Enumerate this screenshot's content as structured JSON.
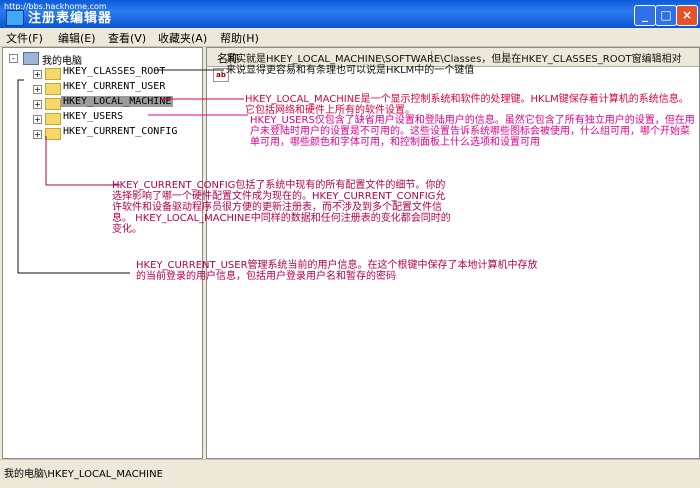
{
  "titlebar": {
    "watermark": "http://bbs.hackhome.com",
    "title": "注册表编辑器",
    "min_glyph": "_",
    "max_glyph": "□",
    "close_glyph": "×"
  },
  "menu": {
    "items": [
      "文件(F)",
      "编辑(E)",
      "查看(V)",
      "收藏夹(A)",
      "帮助(H)"
    ]
  },
  "tree": {
    "root_label": "我的电脑",
    "expander_plus": "+",
    "expander_minus": "-",
    "items": [
      {
        "label": "HKEY_CLASSES_ROOT",
        "selected": false
      },
      {
        "label": "HKEY_CURRENT_USER",
        "selected": false
      },
      {
        "label": "HKEY_LOCAL_MACHINE",
        "selected": true
      },
      {
        "label": "HKEY_USERS",
        "selected": false
      },
      {
        "label": "HKEY_CURRENT_CONFIG",
        "selected": false
      }
    ]
  },
  "list": {
    "column_name": "名称",
    "value_icon": "ab"
  },
  "annotations": {
    "classes_root": "其实就是HKEY_LOCAL_MACHINE\\SOFTWARE\\Classes，但是在HKEY_CLASSES_ROOT窗编辑相对来说显得更容易和有条理也可以说是HKLM中的一个键值",
    "local_machine": "HKEY_LOCAL_MACHINE是一个显示控制系统和软件的处理键。HKLM键保存着计算机的系统信息。它包括网络和硬件上所有的软件设置。",
    "users": "HKEY_USERS仅包含了缺省用户设置和登陆用户的信息。虽然它包含了所有独立用户的设置，但在用户未登陆时用户的设置是不可用的。这些设置告诉系统哪些图标会被使用，什么组可用，哪个开始菜单可用，哪些颜色和字体可用，和控制面板上什么选项和设置可用",
    "current_config": "HKEY_CURRENT_CONFIG包括了系统中现有的所有配置文件的细节。你的选择影响了哪一个硬件配置文件成为现在的。HKEY_CURRENT_CONFIG允许软件和设备驱动程序员很方便的更新注册表，而不涉及到多个配置文件信息。 HKEY_LOCAL_MACHINE中同样的数据和任何注册表的变化都会同时的变化。",
    "current_user": "HKEY_CURRENT_USER管理系统当前的用户信息。在这个根键中保存了本地计算机中存放的当前登录的用户信息，包括用户登录用户名和暂存的密码"
  },
  "status": {
    "path": "我的电脑\\HKEY_LOCAL_MACHINE"
  },
  "colors": {
    "titlebar": "#0A5BD8",
    "annotation_red": "#E0003A",
    "annotation_pink": "#E3008C",
    "annotation_crimson": "#B8004A"
  }
}
